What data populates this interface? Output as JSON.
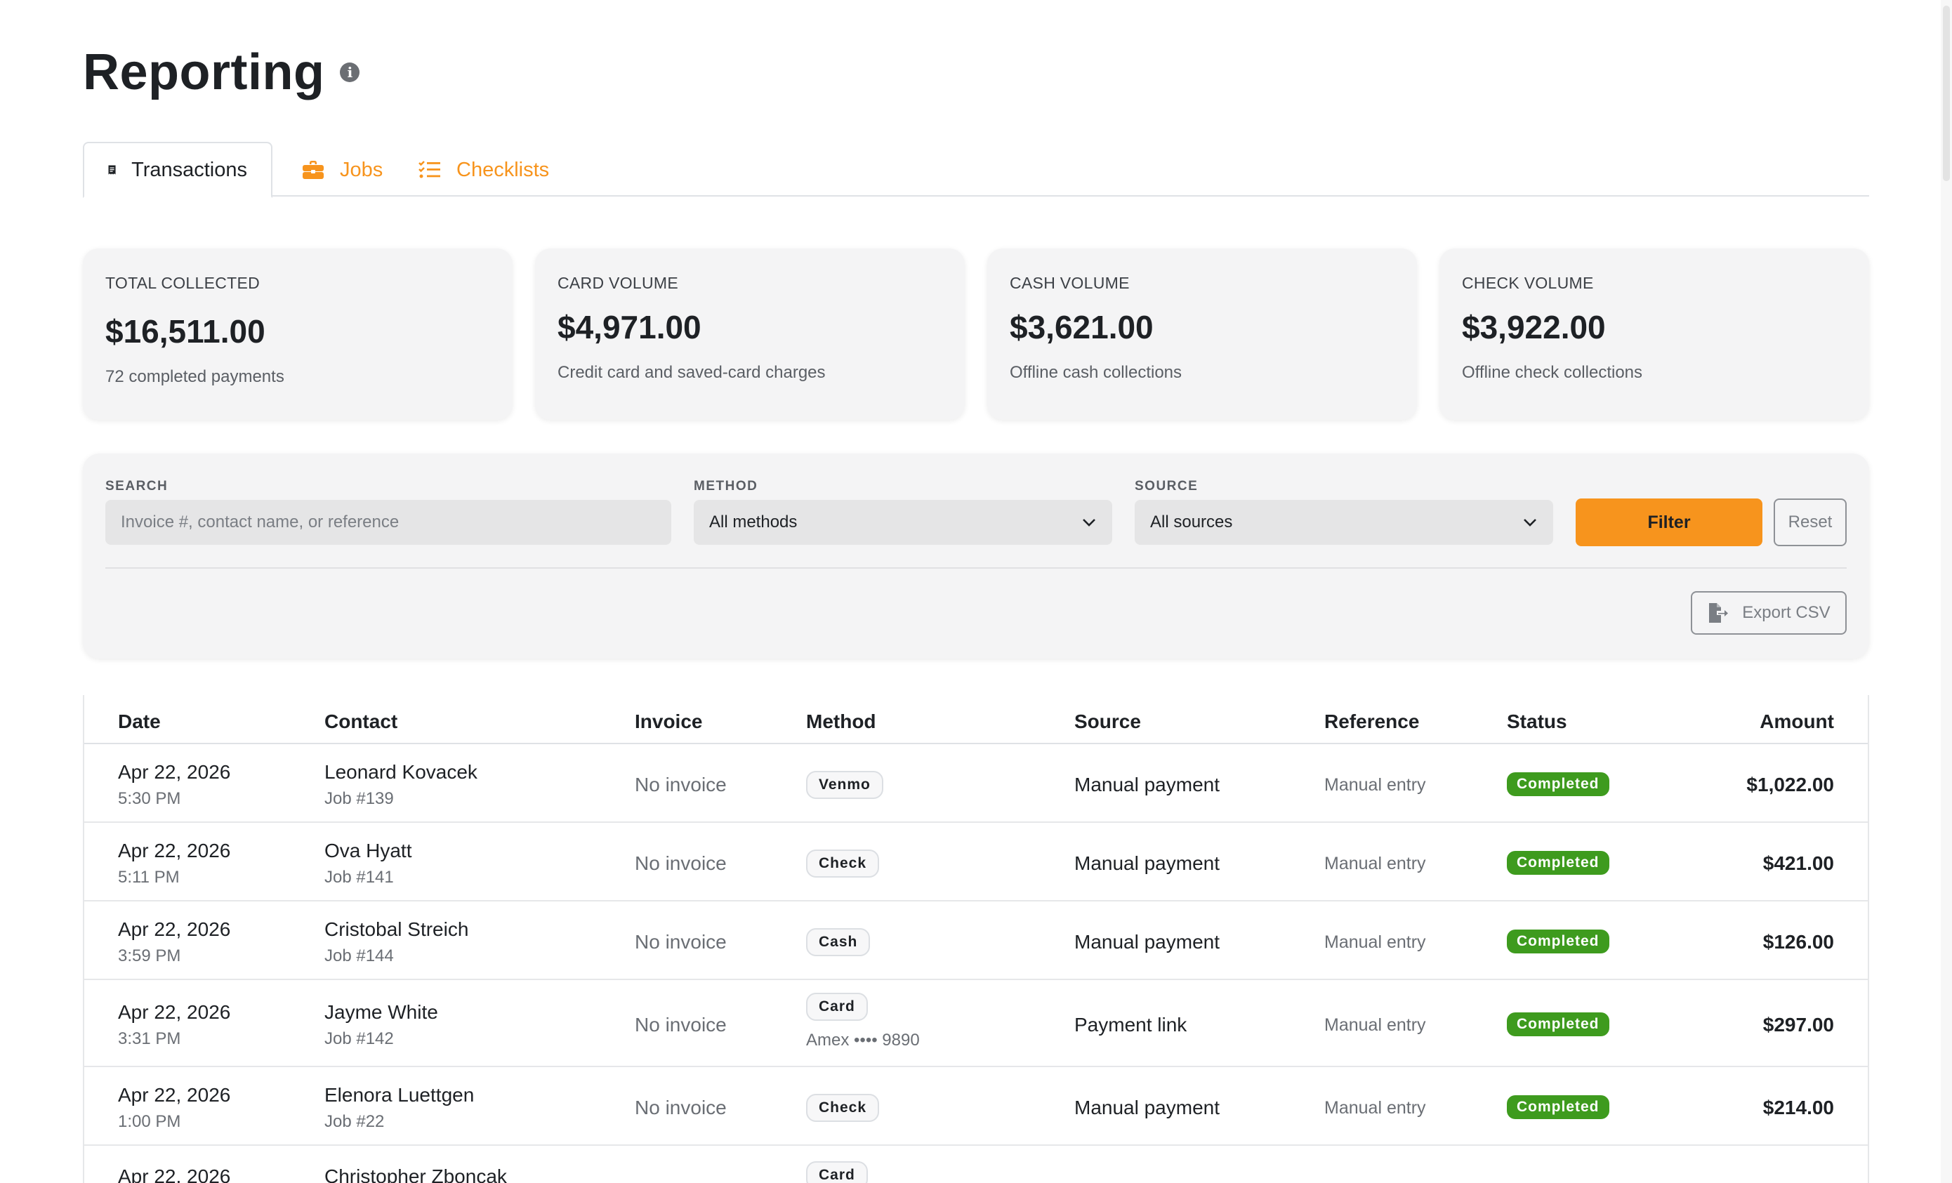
{
  "header": {
    "title": "Reporting",
    "info_icon": "info-circle-icon"
  },
  "tabs": [
    {
      "label": "Transactions",
      "icon": "receipt-icon",
      "active": true
    },
    {
      "label": "Jobs",
      "icon": "briefcase-icon",
      "active": false
    },
    {
      "label": "Checklists",
      "icon": "list-check-icon",
      "active": false
    }
  ],
  "stats": [
    {
      "label": "TOTAL COLLECTED",
      "value": "$16,511.00",
      "desc": "72 completed payments"
    },
    {
      "label": "CARD VOLUME",
      "value": "$4,971.00",
      "desc": "Credit card and saved-card charges"
    },
    {
      "label": "CASH VOLUME",
      "value": "$3,621.00",
      "desc": "Offline cash collections"
    },
    {
      "label": "CHECK VOLUME",
      "value": "$3,922.00",
      "desc": "Offline check collections"
    }
  ],
  "filters": {
    "search_label": "SEARCH",
    "search_placeholder": "Invoice #, contact name, or reference",
    "method_label": "METHOD",
    "method_value": "All methods",
    "source_label": "SOURCE",
    "source_value": "All sources",
    "filter_button": "Filter",
    "reset_button": "Reset",
    "export_button": "Export CSV"
  },
  "table": {
    "columns": [
      "Date",
      "Contact",
      "Invoice",
      "Method",
      "Source",
      "Reference",
      "Status",
      "Amount"
    ],
    "rows": [
      {
        "date": "Apr 22, 2026",
        "time": "5:30 PM",
        "contact": "Leonard Kovacek",
        "job": "Job #139",
        "invoice": "No invoice",
        "method": "Venmo",
        "method_detail": "",
        "source": "Manual payment",
        "reference": "Manual entry",
        "status": "Completed",
        "amount": "$1,022.00"
      },
      {
        "date": "Apr 22, 2026",
        "time": "5:11 PM",
        "contact": "Ova Hyatt",
        "job": "Job #141",
        "invoice": "No invoice",
        "method": "Check",
        "method_detail": "",
        "source": "Manual payment",
        "reference": "Manual entry",
        "status": "Completed",
        "amount": "$421.00"
      },
      {
        "date": "Apr 22, 2026",
        "time": "3:59 PM",
        "contact": "Cristobal Streich",
        "job": "Job #144",
        "invoice": "No invoice",
        "method": "Cash",
        "method_detail": "",
        "source": "Manual payment",
        "reference": "Manual entry",
        "status": "Completed",
        "amount": "$126.00"
      },
      {
        "date": "Apr 22, 2026",
        "time": "3:31 PM",
        "contact": "Jayme White",
        "job": "Job #142",
        "invoice": "No invoice",
        "method": "Card",
        "method_detail": "Amex •••• 9890",
        "source": "Payment link",
        "reference": "Manual entry",
        "status": "Completed",
        "amount": "$297.00"
      },
      {
        "date": "Apr 22, 2026",
        "time": "1:00 PM",
        "contact": "Elenora Luettgen",
        "job": "Job #22",
        "invoice": "No invoice",
        "method": "Check",
        "method_detail": "",
        "source": "Manual payment",
        "reference": "Manual entry",
        "status": "Completed",
        "amount": "$214.00"
      },
      {
        "date": "Apr 22, 2026",
        "time": "",
        "contact": "Christopher Zboncak",
        "job": "",
        "invoice": "",
        "method": "Card",
        "method_detail": "",
        "source": "",
        "reference": "",
        "status": "",
        "amount": ""
      }
    ]
  },
  "colors": {
    "accent": "#f7941d",
    "status_completed": "#3e9b1e",
    "card_bg": "#f4f4f5"
  }
}
